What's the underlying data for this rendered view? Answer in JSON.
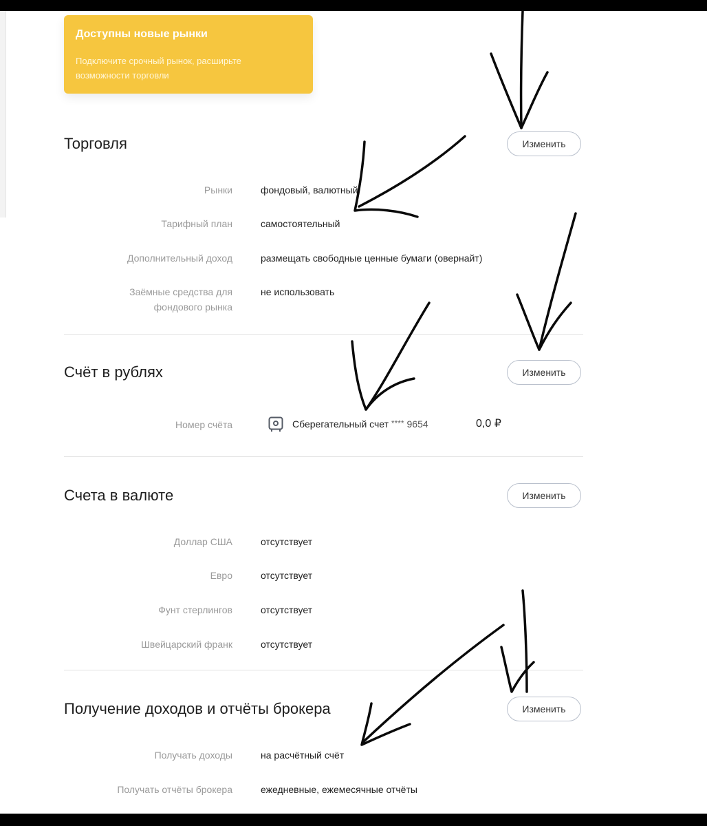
{
  "banner": {
    "title": "Доступны новые рынки",
    "text": "Подключите срочный рынок, расширьте возможности торговли",
    "icon": "globe-icon",
    "color": "#f6c63f"
  },
  "sections": {
    "trading": {
      "title": "Торговля",
      "button": "Изменить",
      "rows": [
        {
          "label": "Рынки",
          "value": "фондовый, валютный"
        },
        {
          "label": "Тарифный план",
          "value": "самостоятельный"
        },
        {
          "label": "Дополнительный доход",
          "value": "размещать свободные ценные бумаги (овернайт)"
        },
        {
          "label_line1": "Заёмные средства для",
          "label_line2": "фондового рынка",
          "value": "не использовать"
        }
      ]
    },
    "rub_account": {
      "title": "Счёт в рублях",
      "button": "Изменить",
      "label": "Номер счёта",
      "account_icon": "safe-icon",
      "account_name": "Сберегательный счет",
      "account_mask": "****",
      "account_digits": "9654",
      "balance": "0,0 ₽"
    },
    "fx_accounts": {
      "title": "Счета в валюте",
      "button": "Изменить",
      "rows": [
        {
          "label": "Доллар США",
          "value": "отсутствует"
        },
        {
          "label": "Евро",
          "value": "отсутствует"
        },
        {
          "label": "Фунт стерлингов",
          "value": "отсутствует"
        },
        {
          "label": "Швейцарский франк",
          "value": "отсутствует"
        }
      ]
    },
    "income": {
      "title": "Получение доходов и отчёты брокера",
      "button": "Изменить",
      "rows": [
        {
          "label": "Получать доходы",
          "value": "на расчётный счёт"
        },
        {
          "label": "Получать отчёты брокера",
          "value": "ежедневные, ежемесячные отчёты"
        }
      ]
    }
  }
}
